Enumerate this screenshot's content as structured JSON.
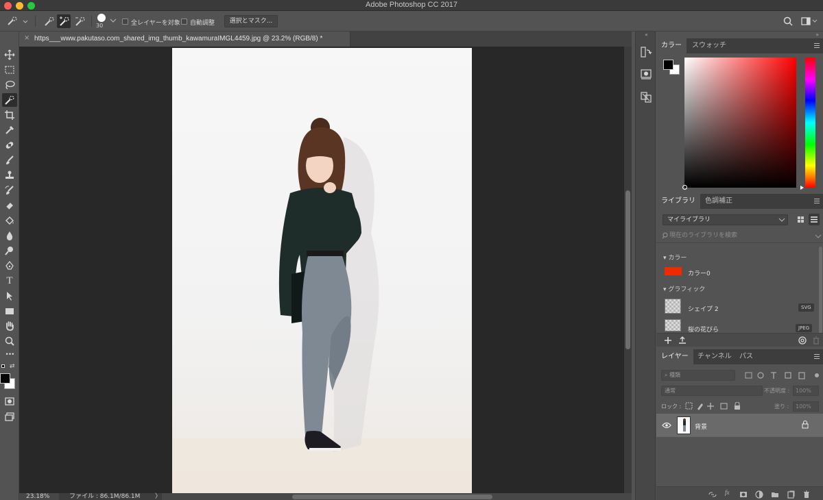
{
  "window": {
    "title": "Adobe Photoshop CC 2017"
  },
  "options": {
    "brush_size": "30",
    "sample_all_layers": "全レイヤーを対象",
    "auto_enhance": "自動調整",
    "select_mask_button": "選択とマスク..."
  },
  "document": {
    "tab_close": "×",
    "tab_title": "https___www.pakutaso.com_shared_img_thumb_kawamuraIMGL4459.jpg @ 23.2% (RGB/8) *"
  },
  "status": {
    "zoom": "23.18%",
    "file_info": "ファイル : 86.1M/86.1M",
    "arrow": "〉"
  },
  "tools": [
    "move-tool",
    "marquee-tool",
    "lasso-tool",
    "quick-selection-tool",
    "crop-tool",
    "eyedropper-tool",
    "healing-brush-tool",
    "brush-tool",
    "stamp-tool",
    "history-brush-tool",
    "eraser-tool",
    "paint-bucket-tool",
    "blur-tool",
    "dodge-tool",
    "pen-tool",
    "type-tool",
    "path-selection-tool",
    "rectangle-tool",
    "hand-tool",
    "zoom-tool",
    "more-tools",
    "default-colors",
    "swap-colors",
    "foreground-color",
    "background-color",
    "quick-mask-mode",
    "screen-mode"
  ],
  "type_tool_glyph": "T",
  "more_tools_glyph": "•••",
  "color_panel": {
    "tabs": [
      "カラー",
      "スウォッチ"
    ],
    "foreground": "#000000",
    "background": "#ffffff",
    "hue": "#ff0000"
  },
  "library_panel": {
    "tabs": [
      "ライブラリ",
      "色調補正"
    ],
    "library_name": "マイライブラリ",
    "search_placeholder": "現在のライブラリを検索",
    "section_colors": "カラー",
    "color_item": {
      "label": "カラー0",
      "swatch": "#ee2a00"
    },
    "section_graphics": "グラフィック",
    "graphics": [
      {
        "label": "シェイプ 2",
        "badge": "SVG"
      },
      {
        "label": "桜の花びら",
        "badge": "JPEG"
      }
    ]
  },
  "layers_panel": {
    "tabs": [
      "レイヤー",
      "チャンネル",
      "パス"
    ],
    "filter_kind": "種類",
    "blend_mode": "通常",
    "opacity_label": "不透明度 :",
    "opacity_value": "100%",
    "lock_label": "ロック :",
    "fill_label": "塗り :",
    "fill_value": "100%",
    "layers": [
      {
        "name": "背景",
        "visible": true,
        "locked": true
      }
    ]
  }
}
